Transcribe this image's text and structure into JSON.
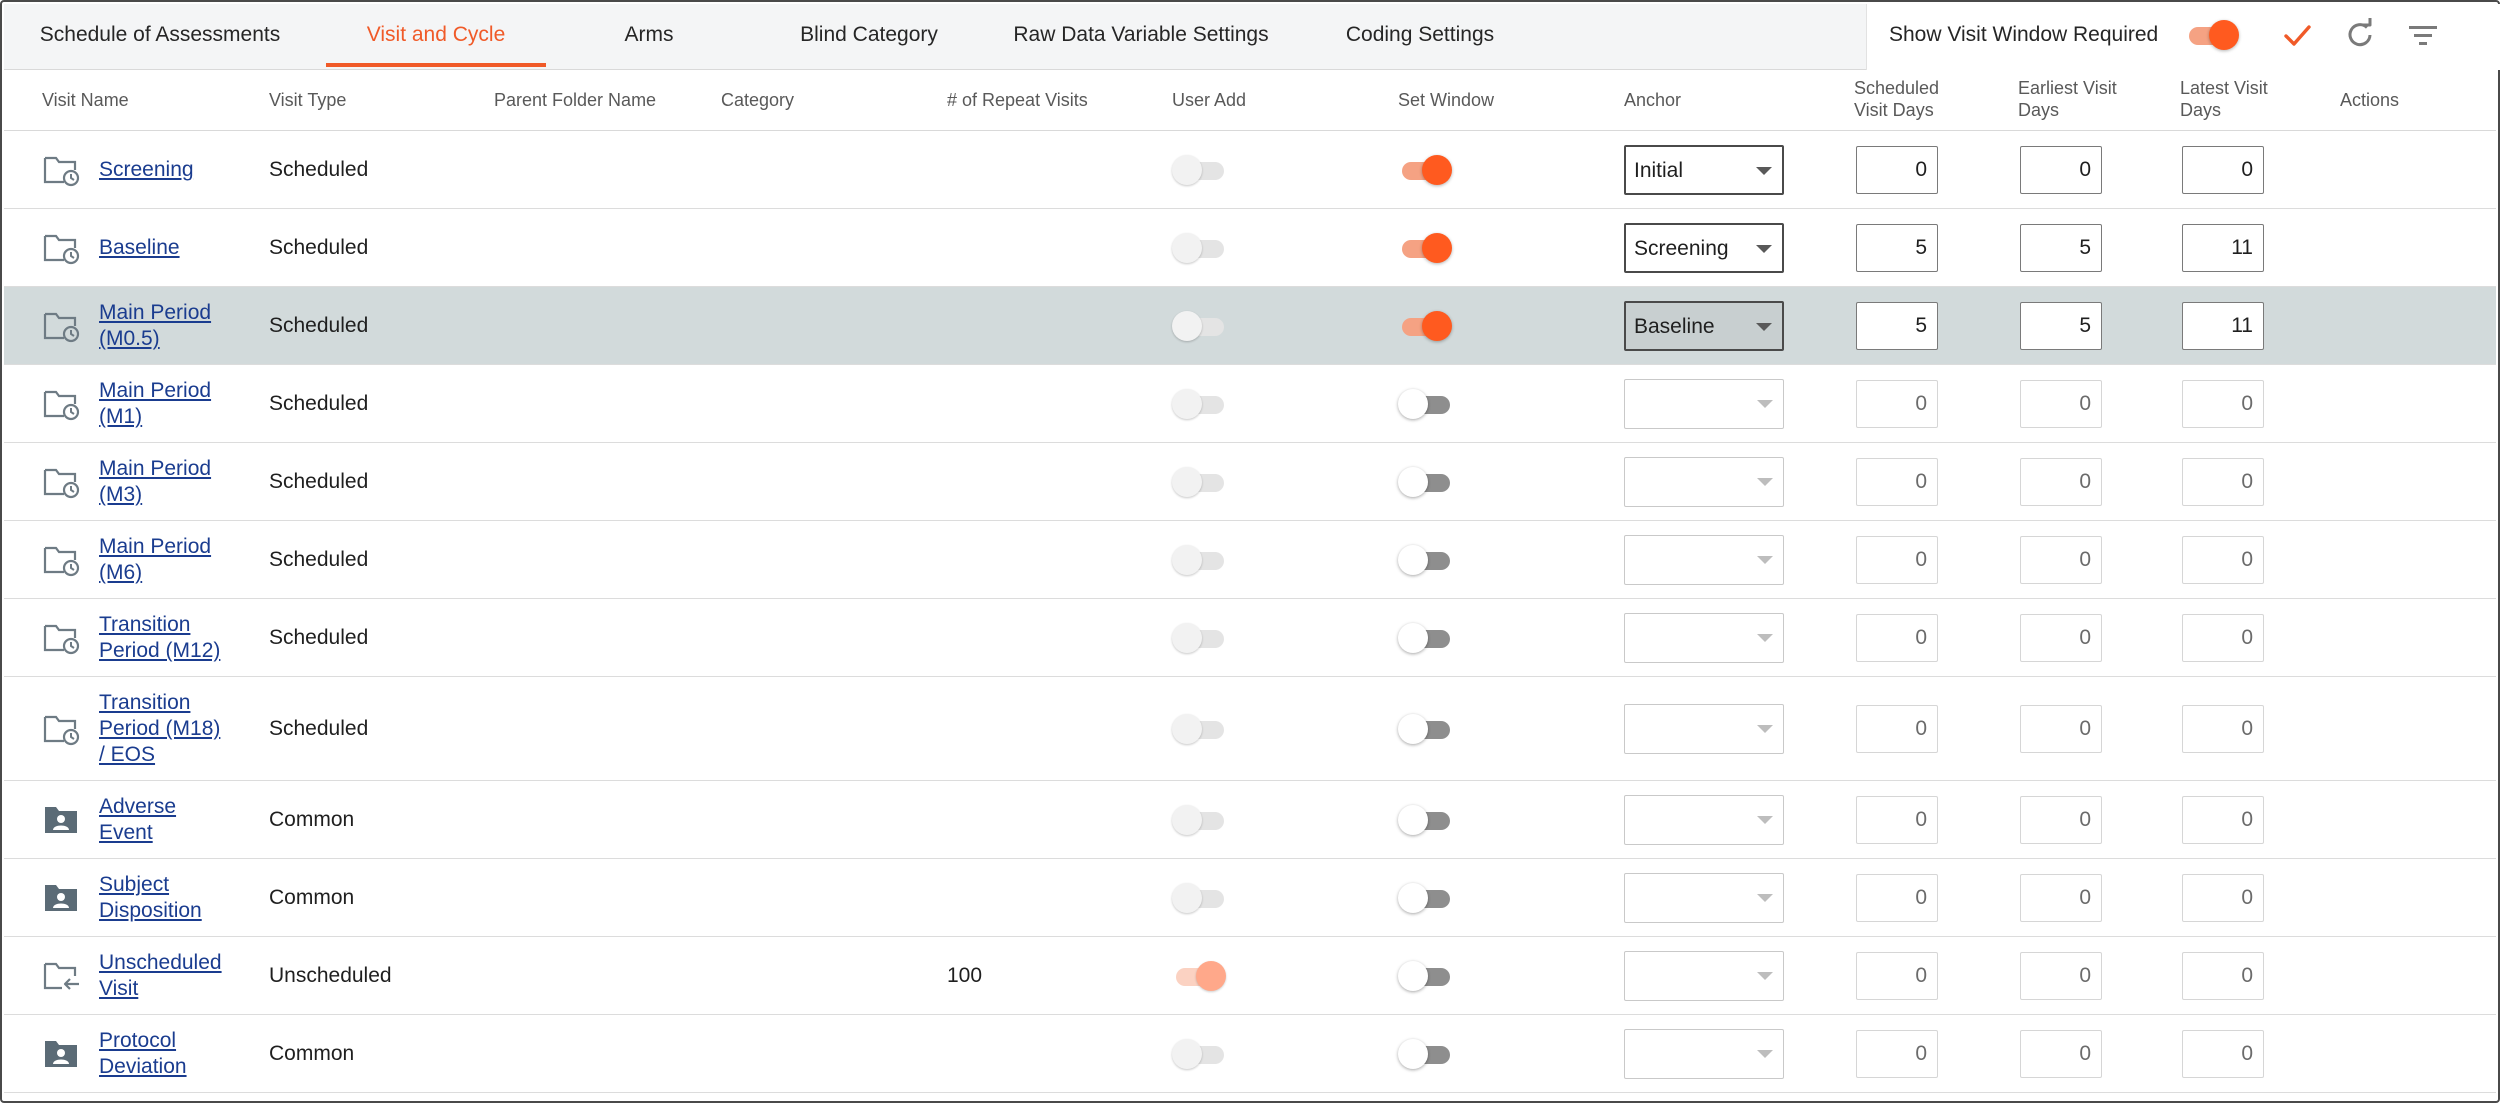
{
  "tabs": [
    {
      "label": "Schedule of Assessments",
      "active": false
    },
    {
      "label": "Visit and Cycle",
      "active": true
    },
    {
      "label": "Arms",
      "active": false
    },
    {
      "label": "Blind Category",
      "active": false
    },
    {
      "label": "Raw Data Variable Settings",
      "active": false
    },
    {
      "label": "Coding Settings",
      "active": false
    }
  ],
  "toolbar": {
    "show_window_label": "Show Visit Window Required",
    "show_window_on": true,
    "icons": [
      "check-icon",
      "refresh-icon",
      "filter-icon"
    ]
  },
  "columns": {
    "visit_name": "Visit Name",
    "visit_type": "Visit Type",
    "parent_folder": "Parent Folder Name",
    "category": "Category",
    "repeat_visits": "# of Repeat Visits",
    "user_add": "User Add",
    "set_window": "Set Window",
    "anchor": "Anchor",
    "scheduled_days_l1": "Scheduled",
    "scheduled_days_l2": "Visit Days",
    "earliest_days_l1": "Earliest Visit",
    "earliest_days_l2": "Days",
    "latest_days_l1": "Latest Visit",
    "latest_days_l2": "Days",
    "actions": "Actions"
  },
  "rows": [
    {
      "name_lines": [
        "Screening"
      ],
      "type": "Scheduled",
      "icon": "scheduled-folder-icon",
      "repeat": "",
      "user_add": false,
      "user_add_faded": true,
      "set_window": true,
      "anchor": "Initial",
      "scheduled": "0",
      "earliest": "0",
      "latest": "0",
      "selected": false
    },
    {
      "name_lines": [
        "Baseline"
      ],
      "type": "Scheduled",
      "icon": "scheduled-folder-icon",
      "repeat": "",
      "user_add": false,
      "user_add_faded": true,
      "set_window": true,
      "anchor": "Screening",
      "scheduled": "5",
      "earliest": "5",
      "latest": "11",
      "selected": false
    },
    {
      "name_lines": [
        "Main Period",
        "(M0.5)"
      ],
      "type": "Scheduled",
      "icon": "scheduled-folder-icon",
      "repeat": "",
      "user_add": false,
      "user_add_faded": true,
      "set_window": true,
      "anchor": "Baseline",
      "scheduled": "5",
      "earliest": "5",
      "latest": "11",
      "selected": true
    },
    {
      "name_lines": [
        "Main Period",
        "(M1)"
      ],
      "type": "Scheduled",
      "icon": "scheduled-folder-icon",
      "repeat": "",
      "user_add": false,
      "user_add_faded": true,
      "set_window": false,
      "anchor": "",
      "scheduled": "0",
      "earliest": "0",
      "latest": "0",
      "selected": false
    },
    {
      "name_lines": [
        "Main Period",
        "(M3)"
      ],
      "type": "Scheduled",
      "icon": "scheduled-folder-icon",
      "repeat": "",
      "user_add": false,
      "user_add_faded": true,
      "set_window": false,
      "anchor": "",
      "scheduled": "0",
      "earliest": "0",
      "latest": "0",
      "selected": false
    },
    {
      "name_lines": [
        "Main Period",
        "(M6)"
      ],
      "type": "Scheduled",
      "icon": "scheduled-folder-icon",
      "repeat": "",
      "user_add": false,
      "user_add_faded": true,
      "set_window": false,
      "anchor": "",
      "scheduled": "0",
      "earliest": "0",
      "latest": "0",
      "selected": false
    },
    {
      "name_lines": [
        "Transition",
        "Period (M12)"
      ],
      "type": "Scheduled",
      "icon": "scheduled-folder-icon",
      "repeat": "",
      "user_add": false,
      "user_add_faded": true,
      "set_window": false,
      "anchor": "",
      "scheduled": "0",
      "earliest": "0",
      "latest": "0",
      "selected": false
    },
    {
      "name_lines": [
        "Transition",
        "Period (M18)",
        "/ EOS"
      ],
      "type": "Scheduled",
      "icon": "scheduled-folder-icon",
      "repeat": "",
      "user_add": false,
      "user_add_faded": true,
      "set_window": false,
      "anchor": "",
      "scheduled": "0",
      "earliest": "0",
      "latest": "0",
      "selected": false
    },
    {
      "name_lines": [
        "Adverse",
        "Event"
      ],
      "type": "Common",
      "icon": "common-folder-icon",
      "repeat": "",
      "user_add": false,
      "user_add_faded": true,
      "set_window": false,
      "anchor": "",
      "scheduled": "0",
      "earliest": "0",
      "latest": "0",
      "selected": false
    },
    {
      "name_lines": [
        "Subject",
        "Disposition"
      ],
      "type": "Common",
      "icon": "common-folder-icon",
      "repeat": "",
      "user_add": false,
      "user_add_faded": true,
      "set_window": false,
      "anchor": "",
      "scheduled": "0",
      "earliest": "0",
      "latest": "0",
      "selected": false
    },
    {
      "name_lines": [
        "Unscheduled",
        "Visit"
      ],
      "type": "Unscheduled",
      "icon": "unscheduled-folder-icon",
      "repeat": "100",
      "user_add": true,
      "user_add_faded": true,
      "set_window": false,
      "anchor": "",
      "scheduled": "0",
      "earliest": "0",
      "latest": "0",
      "selected": false
    },
    {
      "name_lines": [
        "Protocol",
        "Deviation"
      ],
      "type": "Common",
      "icon": "common-folder-icon",
      "repeat": "",
      "user_add": false,
      "user_add_faded": true,
      "set_window": false,
      "anchor": "",
      "scheduled": "0",
      "earliest": "0",
      "latest": "0",
      "selected": false
    }
  ],
  "colors": {
    "accent": "#f05a28",
    "toggle_on": "#ff5a1f",
    "link": "#1a3c8f",
    "selected_row": "#d2dadb"
  }
}
